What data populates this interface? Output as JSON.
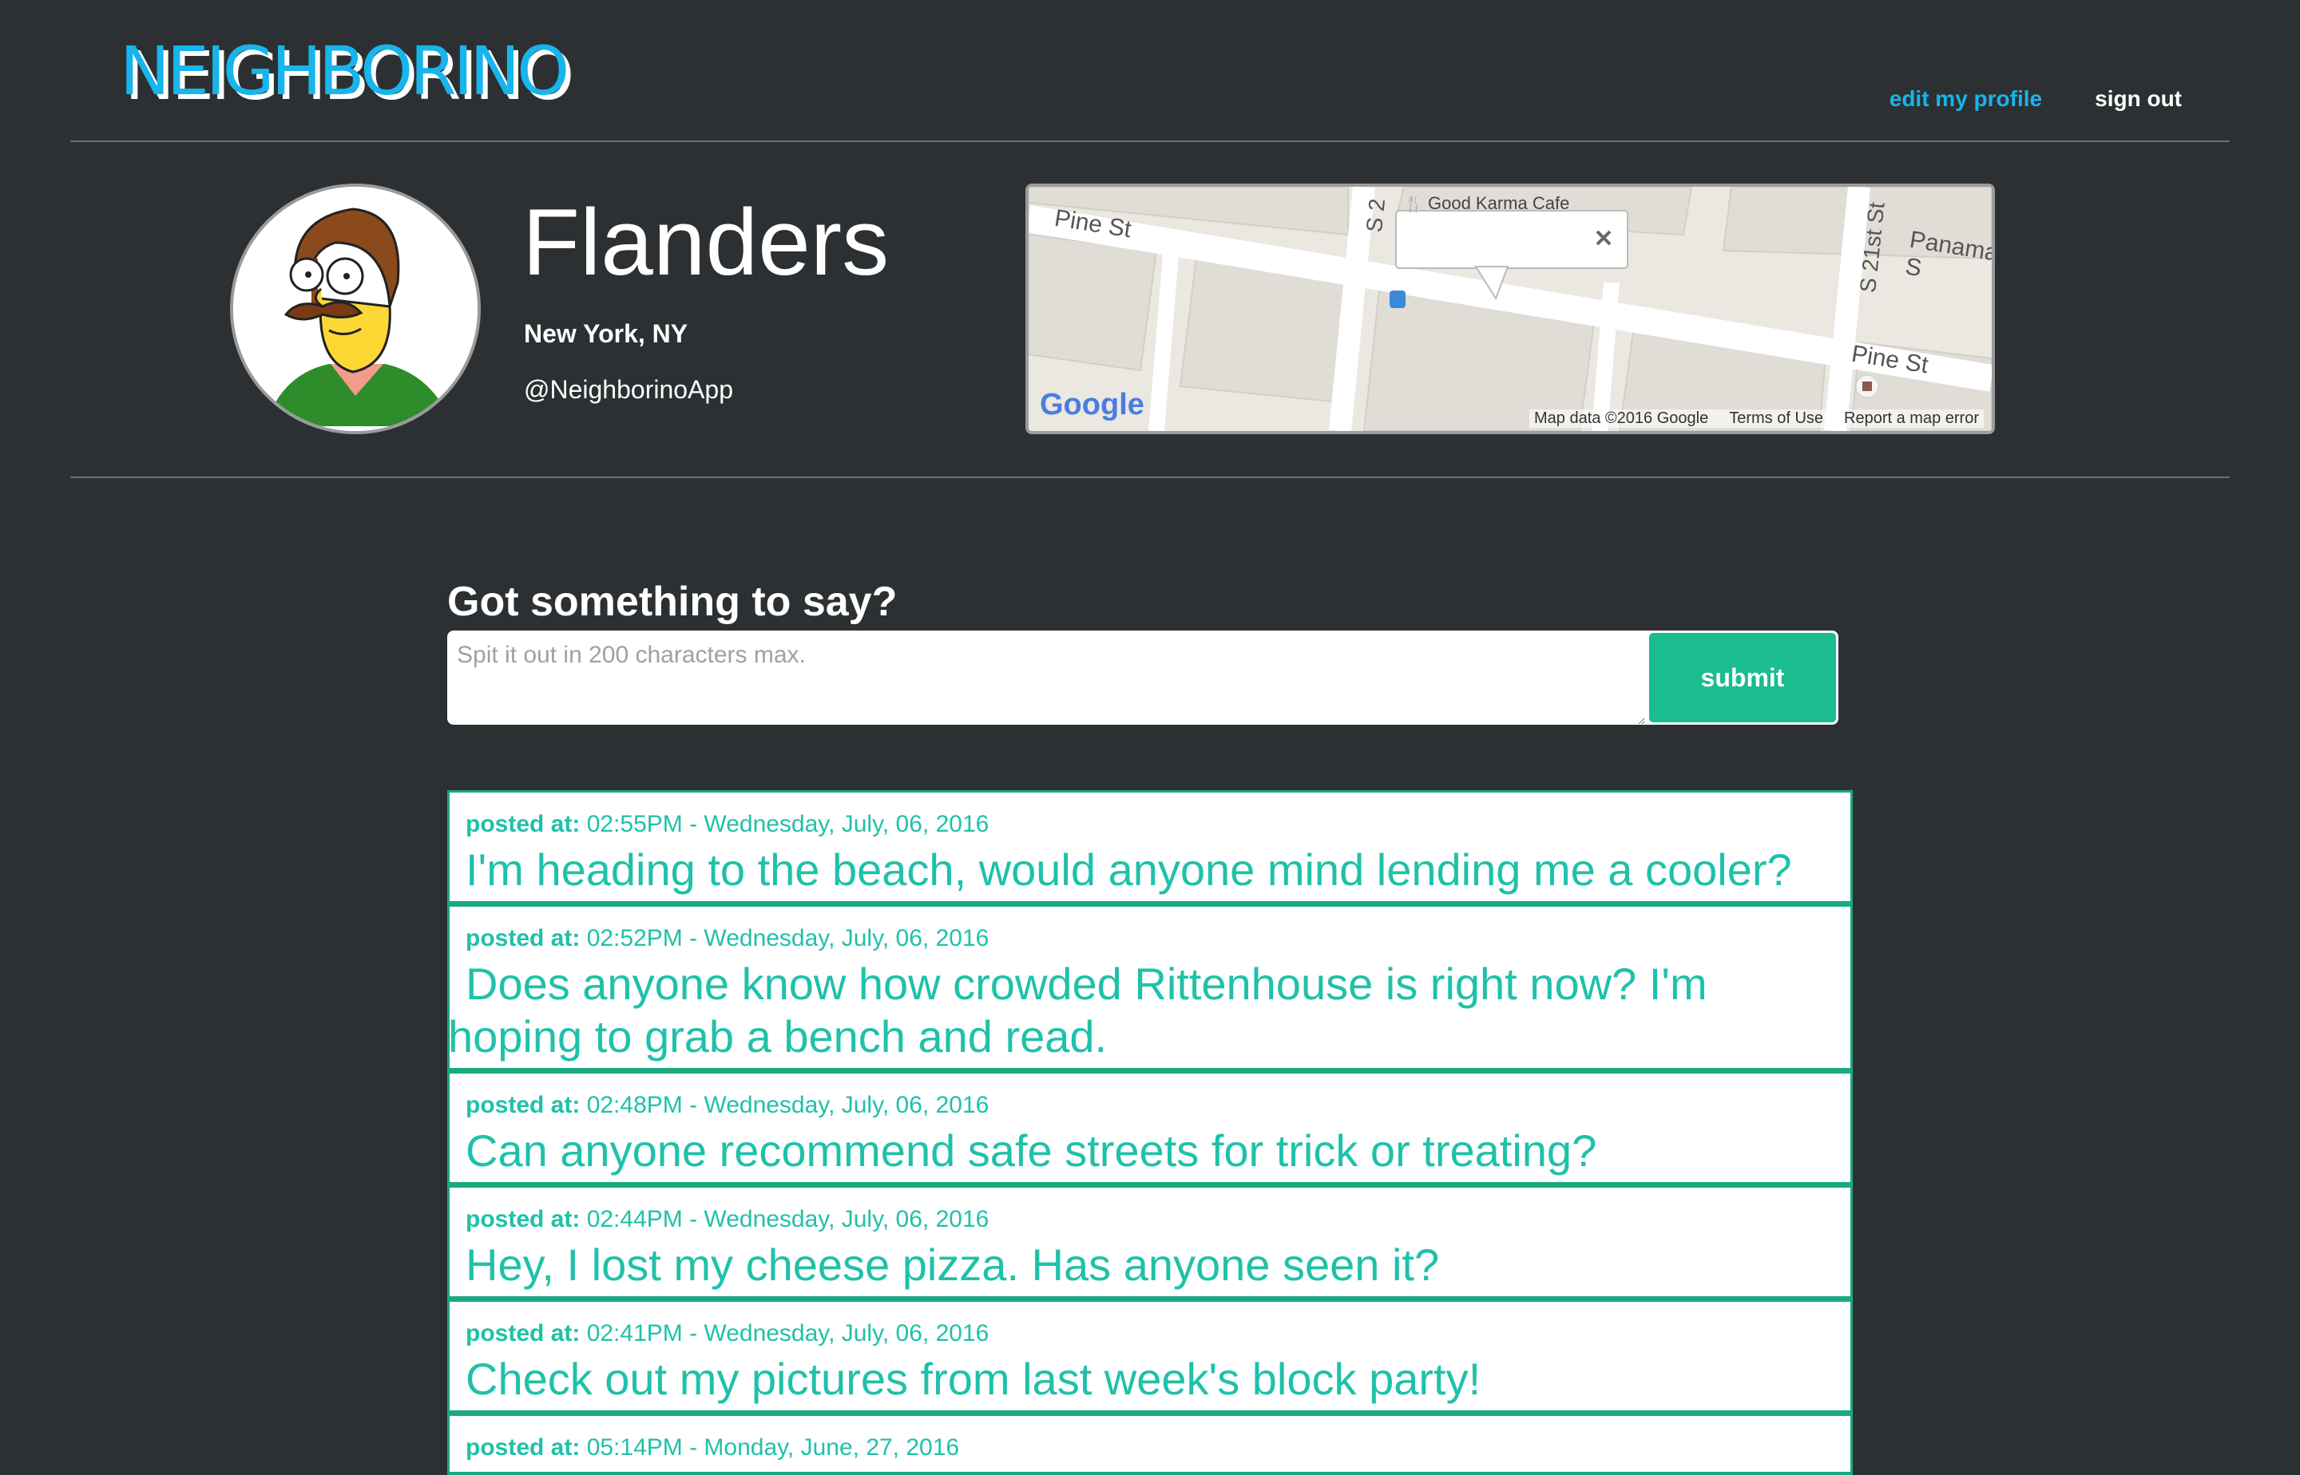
{
  "header": {
    "logo": "NEIGHBORINO",
    "nav": {
      "edit_profile": "edit my profile",
      "sign_out": "sign out"
    }
  },
  "profile": {
    "name": "Flanders",
    "location": "New York, NY",
    "handle": "@NeighborinoApp"
  },
  "map": {
    "labels": {
      "poi": "Good Karma Cafe",
      "pine_st_left": "Pine St",
      "pine_st_right": "Pine St",
      "panama": "Panama S",
      "s21": "S 21st St",
      "s2": "S 2",
      "google": "Google",
      "data": "Map data ©2016 Google",
      "terms": "Terms of Use",
      "report": "Report a map error"
    }
  },
  "composer": {
    "title": "Got something to say?",
    "placeholder": "Spit it out in 200 characters max.",
    "submit": "submit"
  },
  "posts": [
    {
      "label": "posted at:",
      "time": "02:55PM - Wednesday, July, 06, 2016",
      "text": "I'm heading to the beach, would anyone mind lending me a cooler?"
    },
    {
      "label": "posted at:",
      "time": "02:52PM - Wednesday, July, 06, 2016",
      "text": "Does anyone know how crowded Rittenhouse is right now? I'm hoping to grab a bench and read."
    },
    {
      "label": "posted at:",
      "time": "02:48PM - Wednesday, July, 06, 2016",
      "text": "Can anyone recommend safe streets for trick or treating?"
    },
    {
      "label": "posted at:",
      "time": "02:44PM - Wednesday, July, 06, 2016",
      "text": "Hey, I lost my cheese pizza. Has anyone seen it?"
    },
    {
      "label": "posted at:",
      "time": "02:41PM - Wednesday, July, 06, 2016",
      "text": "Check out my pictures from last week's block party!"
    },
    {
      "label": "posted at:",
      "time": "05:14PM - Monday, June, 27, 2016",
      "text": ""
    }
  ],
  "colors": {
    "background": "#2c3032",
    "accent_blue": "#18b4ec",
    "accent_green": "#1abc90",
    "post_text": "#1fc1a9"
  }
}
